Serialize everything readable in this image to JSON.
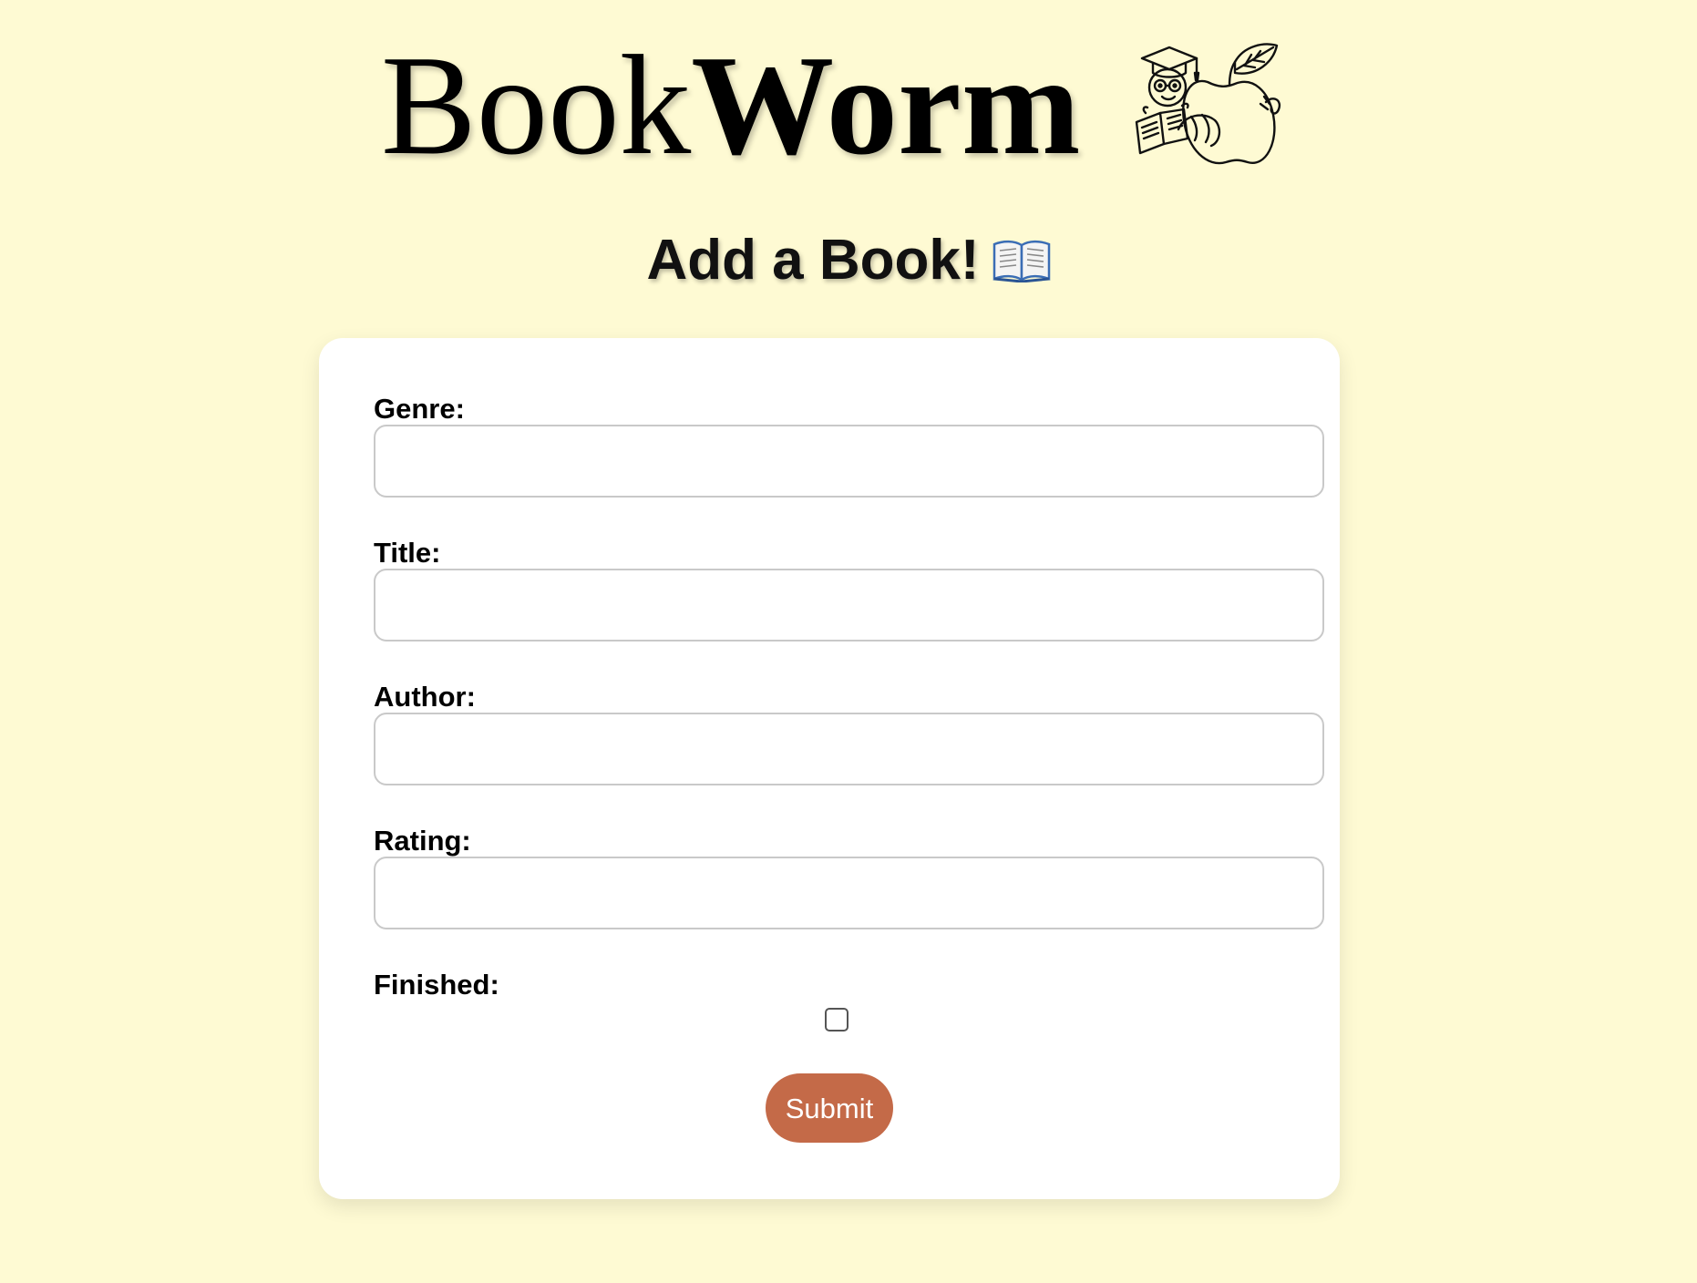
{
  "brand": {
    "name_part1": "Book",
    "name_part2": "Worm",
    "logo_icon": "bookworm-mascot-icon"
  },
  "page": {
    "heading": "Add a Book!",
    "heading_icon": "open-book-icon",
    "background_color": "#fefad3"
  },
  "form": {
    "fields": [
      {
        "label": "Genre:",
        "value": ""
      },
      {
        "label": "Title:",
        "value": ""
      },
      {
        "label": "Author:",
        "value": ""
      },
      {
        "label": "Rating:",
        "value": ""
      }
    ],
    "finished": {
      "label": "Finished:",
      "checked": false
    },
    "submit_label": "Submit",
    "submit_color": "#c46a48"
  }
}
